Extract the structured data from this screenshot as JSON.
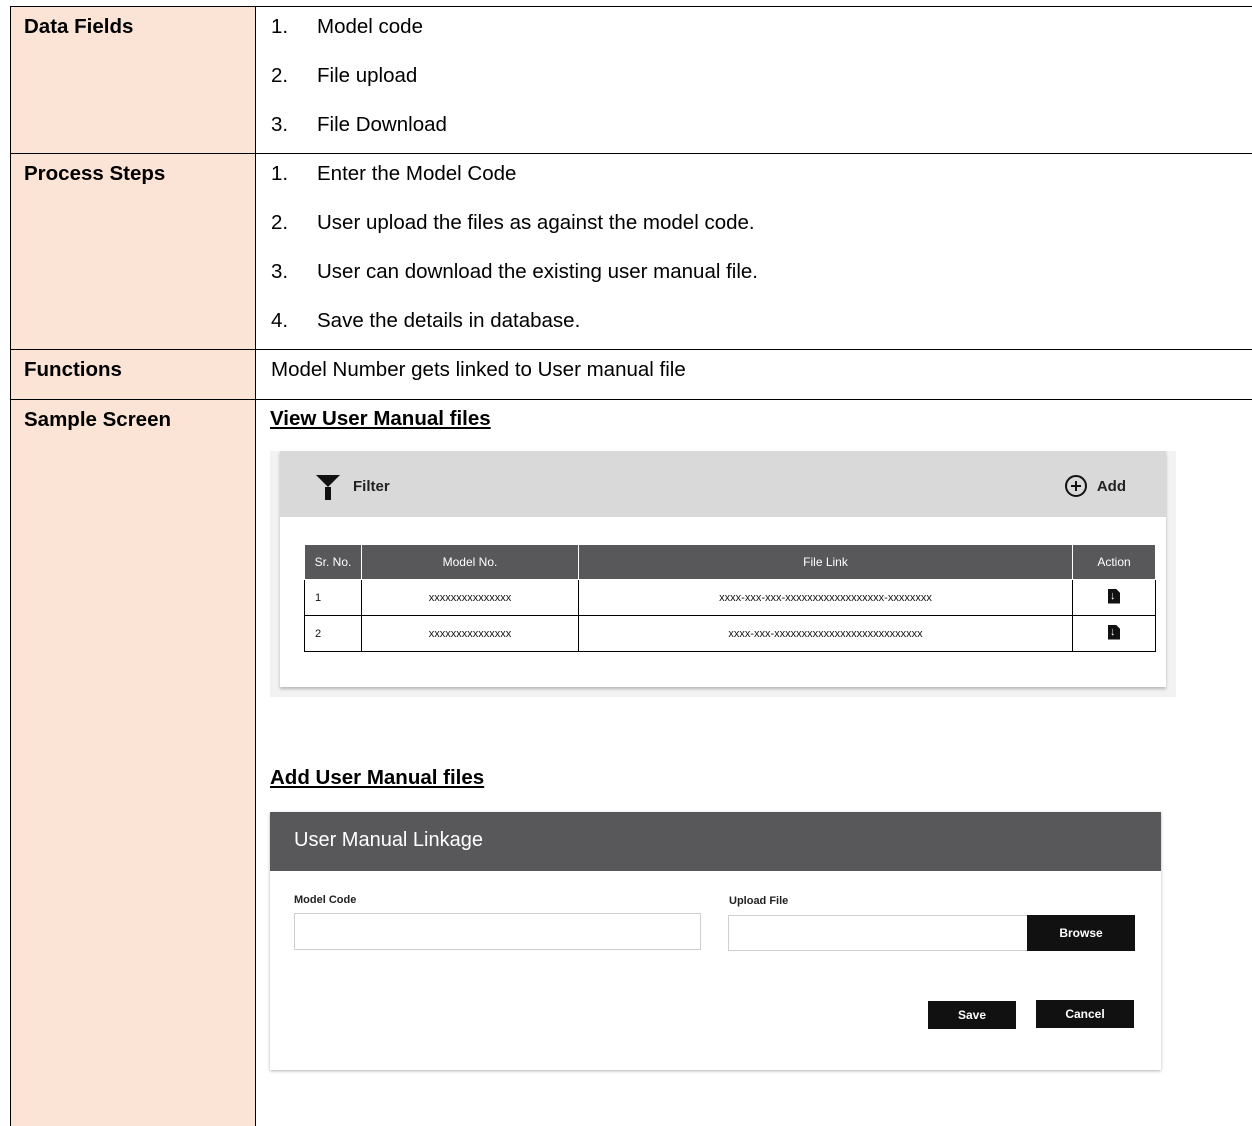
{
  "table": {
    "data_fields": {
      "label": "Data Fields",
      "items": [
        {
          "num": "1.",
          "text": "Model code"
        },
        {
          "num": "2.",
          "text": "File upload"
        },
        {
          "num": "3.",
          "text": "File Download"
        }
      ]
    },
    "process_steps": {
      "label": "Process Steps",
      "items": [
        {
          "num": "1.",
          "text": "Enter the Model Code"
        },
        {
          "num": "2.",
          "text": "User upload the files as against the model code."
        },
        {
          "num": "3.",
          "text": "User can download the existing user manual file."
        },
        {
          "num": "4.",
          "text": "Save the details in database."
        }
      ]
    },
    "functions": {
      "label": "Functions",
      "text": "Model Number gets linked to User manual file"
    },
    "sample_screen": {
      "label": "Sample Screen",
      "view_heading": "View User Manual files",
      "add_heading": "Add User Manual files"
    }
  },
  "view_screen": {
    "filter_label": "Filter",
    "add_label": "Add",
    "columns": [
      "Sr. No.",
      "Model No.",
      "File Link",
      "Action"
    ],
    "rows": [
      {
        "sr": "1",
        "model": "xxxxxxxxxxxxxxx",
        "link": "xxxx-xxx-xxx-xxxxxxxxxxxxxxxxxx-xxxxxxxx"
      },
      {
        "sr": "2",
        "model": "xxxxxxxxxxxxxxx",
        "link": "xxxx-xxx-xxxxxxxxxxxxxxxxxxxxxxxxxxx"
      }
    ]
  },
  "add_screen": {
    "title": "User Manual Linkage",
    "model_code_label": "Model Code",
    "upload_label": "Upload File",
    "browse_label": "Browse",
    "save_label": "Save",
    "cancel_label": "Cancel"
  },
  "icons": [
    "filter-icon",
    "add-circle-icon",
    "file-download-icon"
  ],
  "colors": {
    "label_bg": "#fbe4d5",
    "header_gray": "#58585a",
    "filter_bar": "#d9d9d9",
    "button": "#111111"
  }
}
